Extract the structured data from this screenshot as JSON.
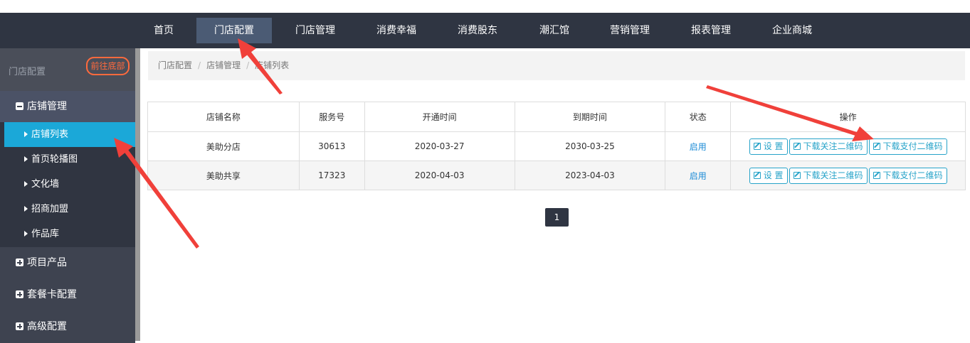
{
  "topnav": {
    "items": [
      "首页",
      "门店配置",
      "门店管理",
      "消费幸福",
      "消费股东",
      "潮汇馆",
      "营销管理",
      "报表管理",
      "企业商城"
    ],
    "active_index": 1
  },
  "sidebar": {
    "title": "门店配置",
    "to_bottom_label": "前往底部",
    "groups": [
      {
        "label": "店铺管理",
        "expanded": true
      },
      {
        "label": "项目产品",
        "expanded": false
      },
      {
        "label": "套餐卡配置",
        "expanded": false
      },
      {
        "label": "高级配置",
        "expanded": false
      }
    ],
    "sub_items": [
      "店铺列表",
      "首页轮播图",
      "文化墙",
      "招商加盟",
      "作品库"
    ],
    "active_sub_index": 0
  },
  "breadcrumb": [
    "门店配置",
    "店铺管理",
    "店铺列表"
  ],
  "table": {
    "headers": [
      "店铺名称",
      "服务号",
      "开通时间",
      "到期时间",
      "状态",
      "操作"
    ],
    "rows": [
      {
        "name": "美助分店",
        "service_no": "30613",
        "open_date": "2020-03-27",
        "expire_date": "2030-03-25",
        "status": "启用"
      },
      {
        "name": "美助共享",
        "service_no": "17323",
        "open_date": "2020-04-03",
        "expire_date": "2023-04-03",
        "status": "启用"
      }
    ],
    "actions": [
      "设 置",
      "下载关注二维码",
      "下载支付二维码"
    ]
  },
  "pagination": {
    "current": "1"
  },
  "colors": {
    "annotation_arrow": "#f0403a",
    "topbar": "#2f3542",
    "active_sub": "#1ba8d8",
    "accent_orange": "#ff6a3d"
  },
  "icons": {
    "collapse": "minus-square-icon",
    "expand": "plus-square-icon",
    "submenu": "caret-right-icon",
    "edit": "edit-icon"
  }
}
